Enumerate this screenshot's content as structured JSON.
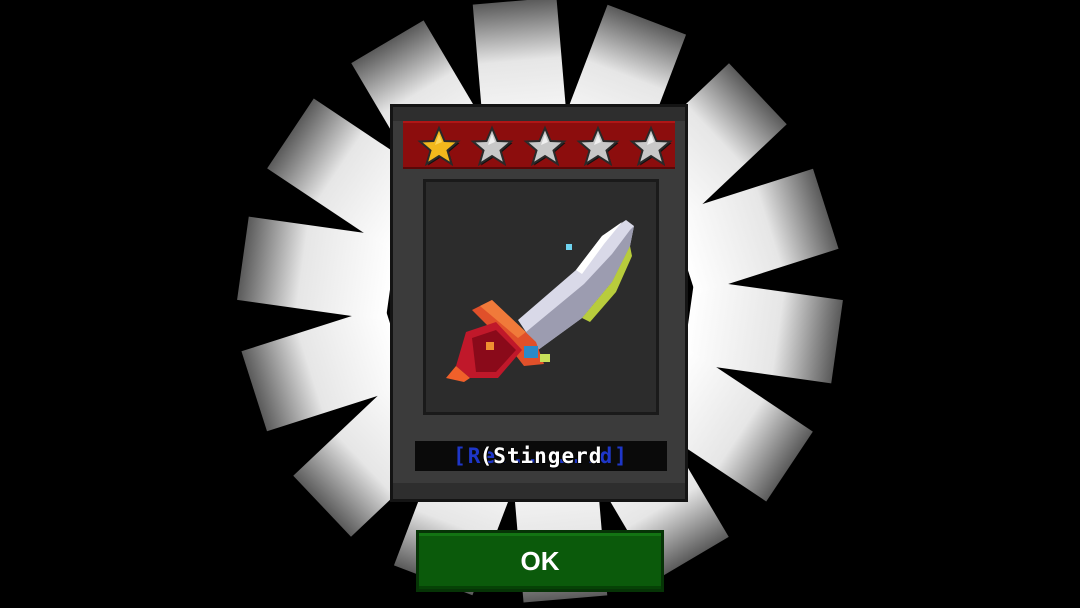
{
  "reward_card": {
    "rarity_stars_filled": 1,
    "rarity_stars_total": 5,
    "item_icon": "pixel-sword-icon",
    "item_name": "(Stingerd",
    "item_name_ghost": "[Re...                ...d]"
  },
  "ok_button": {
    "label": "OK"
  },
  "colors": {
    "background": "#000000",
    "star_bar": "#8c0d0d",
    "star_filled": "#f2b81c",
    "star_empty": "#c8c8c8",
    "ok_button": "#0b5a0b",
    "name_ghost": "#1e36c8"
  }
}
